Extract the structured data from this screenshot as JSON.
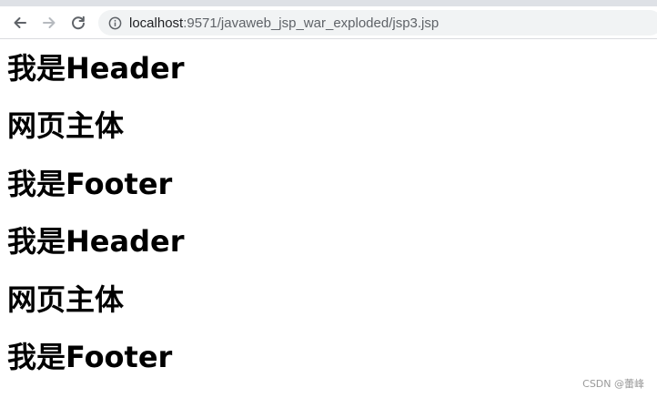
{
  "browser": {
    "url_host": "localhost",
    "url_path": ":9571/javaweb_jsp_war_exploded/jsp3.jsp",
    "icons": {
      "back": "arrow-left-icon",
      "forward": "arrow-right-icon",
      "reload": "reload-icon",
      "site_info": "info-icon"
    }
  },
  "page": {
    "headings": [
      "我是Header",
      "网页主体",
      "我是Footer",
      "我是Header",
      "网页主体",
      "我是Footer"
    ]
  },
  "watermark": "CSDN @蕾峰"
}
